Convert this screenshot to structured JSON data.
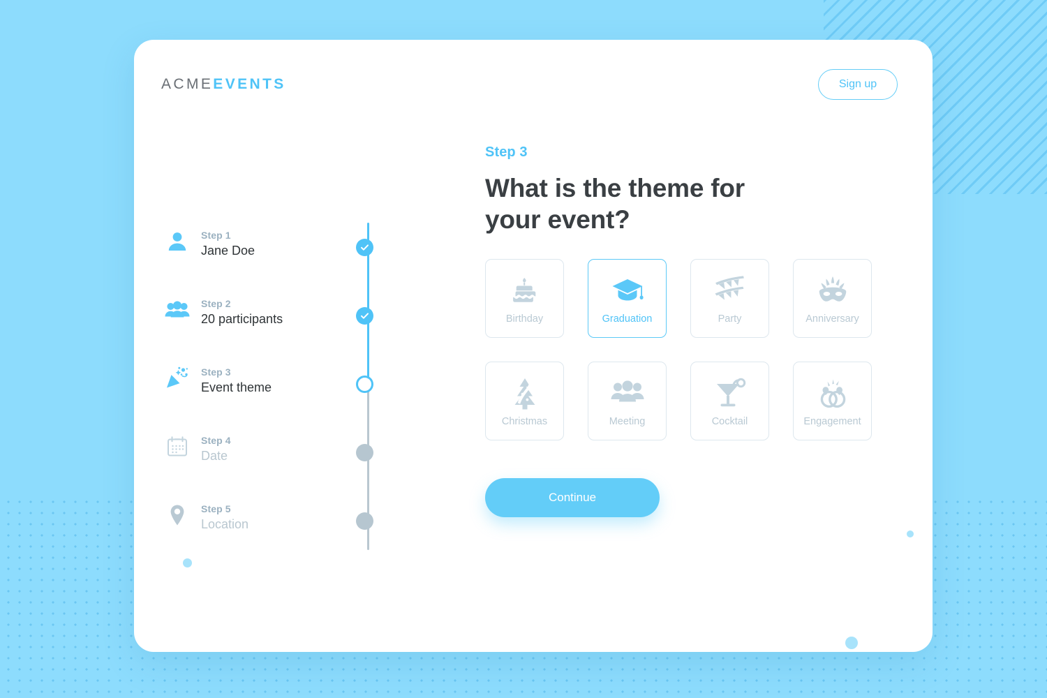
{
  "brand": {
    "logo_primary": "ACME",
    "logo_accent": "EVENTS"
  },
  "header": {
    "signup_label": "Sign up"
  },
  "stepper": {
    "steps": [
      {
        "kicker": "Step 1",
        "title": "Jane Doe",
        "icon": "person-icon",
        "state": "done"
      },
      {
        "kicker": "Step 2",
        "title": "20 participants",
        "icon": "people-icon",
        "state": "done"
      },
      {
        "kicker": "Step 3",
        "title": "Event theme",
        "icon": "party-popper-icon",
        "state": "current"
      },
      {
        "kicker": "Step 4",
        "title": "Date",
        "icon": "calendar-icon",
        "state": "todo"
      },
      {
        "kicker": "Step 5",
        "title": "Location",
        "icon": "map-pin-icon",
        "state": "todo"
      }
    ]
  },
  "main": {
    "step_label": "Step 3",
    "headline": "What is the theme for your event?",
    "continue_label": "Continue",
    "themes": [
      {
        "label": "Birthday",
        "icon": "birthday-cake-icon",
        "selected": false
      },
      {
        "label": "Graduation",
        "icon": "graduation-cap-icon",
        "selected": true
      },
      {
        "label": "Party",
        "icon": "bunting-flags-icon",
        "selected": false
      },
      {
        "label": "Anniversary",
        "icon": "carnival-mask-icon",
        "selected": false
      },
      {
        "label": "Christmas",
        "icon": "christmas-tree-icon",
        "selected": false
      },
      {
        "label": "Meeting",
        "icon": "people-group-icon",
        "selected": false
      },
      {
        "label": "Cocktail",
        "icon": "cocktail-glass-icon",
        "selected": false
      },
      {
        "label": "Engagement",
        "icon": "engagement-rings-icon",
        "selected": false
      }
    ]
  },
  "colors": {
    "accent": "#4fc3f7",
    "accent_button": "#63cdf8",
    "background": "#8ddcfd",
    "muted": "#b9c9d3",
    "text_dark": "#3a3f43",
    "kicker": "#9bb1c0"
  }
}
